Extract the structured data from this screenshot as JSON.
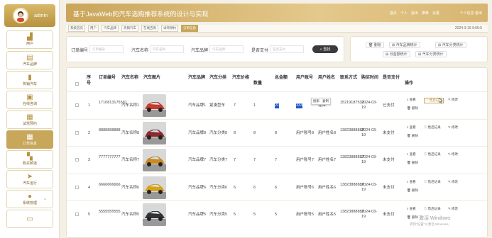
{
  "app": {
    "admin_name": "admin",
    "title": "基于JavaWeb的汽车选购推荐系统的设计与实现",
    "header_links": [
      "首页",
      "个人",
      "退出",
      "推荐",
      "设置"
    ],
    "user_center": "个人信息 退出",
    "datetime": "2024-3-19 9:55:5"
  },
  "sidebar": {
    "items": [
      {
        "label": "用户",
        "icon": "chart-icon"
      },
      {
        "label": "汽车品牌",
        "icon": "chat-icon"
      },
      {
        "label": "热销汽车",
        "icon": "book-icon"
      },
      {
        "label": "在线咨询",
        "icon": "bag-icon"
      },
      {
        "label": "试驾预约",
        "icon": "doc-icon"
      },
      {
        "label": "订单信息",
        "icon": "grid-icon"
      },
      {
        "label": "购买频道",
        "icon": "bookmark-icon"
      },
      {
        "label": "汽车运行",
        "icon": "send-icon"
      },
      {
        "label": "系统管理",
        "icon": "user-icon"
      },
      {
        "label": "",
        "icon": "card-icon"
      }
    ]
  },
  "breadcrumb": [
    "系统首页",
    "用户",
    "汽车品牌",
    "热销汽车",
    "在线咨询",
    "试驾预约",
    "订单信息"
  ],
  "search": {
    "labels": [
      "订单编号",
      "汽车名称",
      "汽车品牌",
      "是否支付"
    ],
    "placeholders": [
      "订单编号",
      "汽车名称",
      "汽车品牌",
      "是否支付"
    ],
    "button": "查找"
  },
  "actions": {
    "row1": [
      "删除",
      "汽车品牌统计",
      "汽车分类统计"
    ],
    "row2": [
      "月金额统计",
      "汽车分类统计"
    ]
  },
  "table": {
    "headers": [
      "序号",
      "订单编号",
      "汽车名称",
      "汽车图片",
      "汽车品牌",
      "汽车分类",
      "汽车价格",
      "数量",
      "总金额",
      "用户账号",
      "用户姓名",
      "联系方式",
      "购买时间",
      "是否支付",
      "操作"
    ],
    "rows": [
      {
        "no": "1",
        "order": "1710813175591",
        "name": "汽车名称1",
        "brand": "汽车品牌1",
        "category": "紧凑型车",
        "price": "7",
        "qty": "1",
        "total": "21",
        "account": "333",
        "uname": "程泽",
        "phone": "15219187533",
        "time": "2024-03-19",
        "paid": "已支付",
        "color": "#c83a2a"
      },
      {
        "no": "2",
        "order": "8888888888",
        "name": "汽车名称8",
        "brand": "汽车品牌8",
        "category": "汽车分类8",
        "price": "8",
        "qty": "8",
        "total": "8",
        "account": "用户账号8",
        "uname": "用户姓名8",
        "phone": "13823888888",
        "time": "2024-03-19",
        "paid": "未支付",
        "color": "#8a2a2a"
      },
      {
        "no": "3",
        "order": "7777777777",
        "name": "汽车名称7",
        "brand": "汽车品牌7",
        "category": "汽车分类7",
        "price": "7",
        "qty": "7",
        "total": "7",
        "account": "用户账号7",
        "uname": "用户姓名7",
        "phone": "13823888887",
        "time": "2024-03-19",
        "paid": "未支付",
        "color": "#c98a22"
      },
      {
        "no": "4",
        "order": "6666666666",
        "name": "汽车名称6",
        "brand": "汽车品牌6",
        "category": "汽车分类6",
        "price": "6",
        "qty": "6",
        "total": "6",
        "account": "用户账号6",
        "uname": "用户姓名6",
        "phone": "13823888886",
        "time": "2024-03-19",
        "paid": "未支付",
        "color": "#d6a21e"
      },
      {
        "no": "5",
        "order": "5555555555",
        "name": "汽车名称5",
        "brand": "汽车品牌5",
        "category": "汽车分类5",
        "price": "5",
        "qty": "5",
        "total": "5",
        "account": "用户账号5",
        "uname": "用户姓名5",
        "phone": "13823888885",
        "time": "2024-03-19",
        "paid": "未支付",
        "color": "#333333"
      }
    ],
    "ops": [
      "查看",
      "售后记录",
      "修改",
      "删除"
    ],
    "tooltip": [
      "搜索",
      "复制"
    ]
  },
  "watermark": {
    "line1": "激活 Windows",
    "line2": "转到\"设置\"以激活 Windows。"
  }
}
